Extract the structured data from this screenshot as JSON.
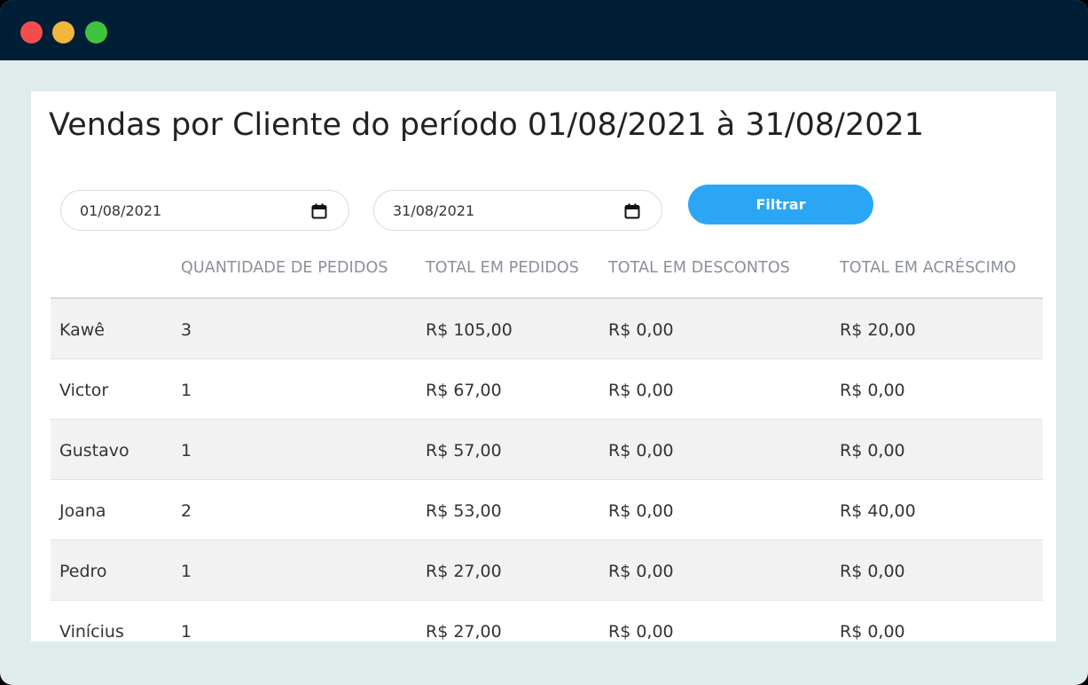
{
  "page": {
    "title": "Vendas por Cliente do período 01/08/2021 à 31/08/2021"
  },
  "filters": {
    "start_date": "01/08/2021",
    "end_date": "31/08/2021",
    "filter_label": "Filtrar",
    "calendar_icon": "calendar-icon"
  },
  "table": {
    "headers": [
      "",
      "QUANTIDADE DE PEDIDOS",
      "TOTAL EM PEDIDOS",
      "TOTAL EM DESCONTOS",
      "TOTAL EM ACRÉSCIMO"
    ],
    "rows": [
      [
        "Kawê",
        "3",
        "R$ 105,00",
        "R$ 0,00",
        "R$ 20,00"
      ],
      [
        "Victor",
        "1",
        "R$ 67,00",
        "R$ 0,00",
        "R$ 0,00"
      ],
      [
        "Gustavo",
        "1",
        "R$ 57,00",
        "R$ 0,00",
        "R$ 0,00"
      ],
      [
        "Joana",
        "2",
        "R$ 53,00",
        "R$ 0,00",
        "R$ 40,00"
      ],
      [
        "Pedro",
        "1",
        "R$ 27,00",
        "R$ 0,00",
        "R$ 0,00"
      ],
      [
        "Vinícius",
        "1",
        "R$ 27,00",
        "R$ 0,00",
        "R$ 0,00"
      ]
    ]
  },
  "colors": {
    "titlebar": "#001f37",
    "filter_button": "#2aa6f5",
    "row_stripe": "#f2f2f2"
  }
}
